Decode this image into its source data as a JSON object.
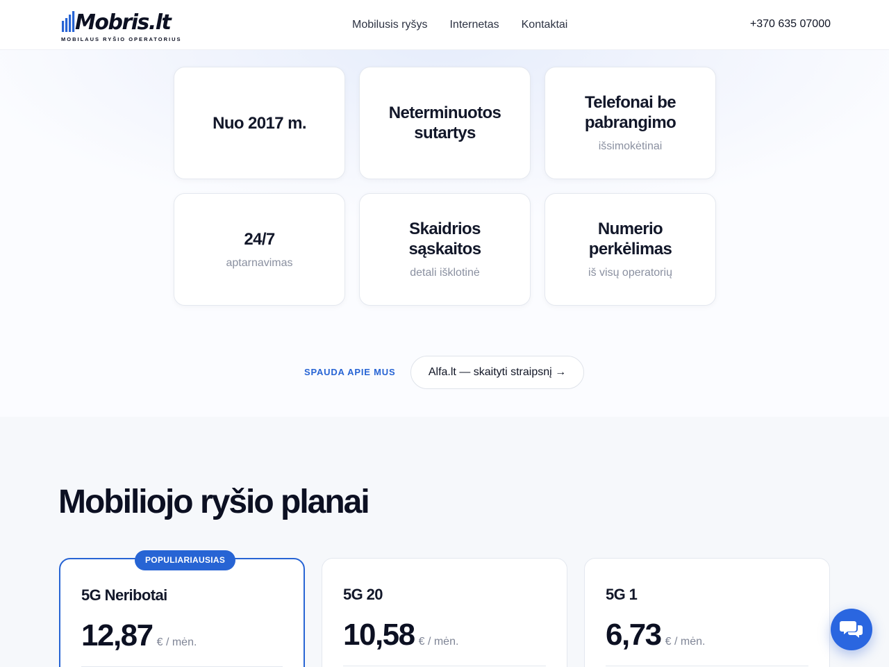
{
  "brand": {
    "name": "Mobris.lt",
    "tagline": "MOBILAUS RYŠIO OPERATORIUS",
    "accent": "#2764d4"
  },
  "nav": {
    "items": [
      "Mobilusis ryšys",
      "Internetas",
      "Kontaktai"
    ],
    "phone": "+370 635 07000"
  },
  "features": [
    {
      "title": "Nuo 2017 m.",
      "subtitle": ""
    },
    {
      "title": "Neterminuotos sutartys",
      "subtitle": ""
    },
    {
      "title": "Telefonai be pabrangimo",
      "subtitle": "išsimokėtinai"
    },
    {
      "title": "24/7",
      "subtitle": "aptarnavimas"
    },
    {
      "title": "Skaidrios sąskaitos",
      "subtitle": "detali išklotinė"
    },
    {
      "title": "Numerio perkėlimas",
      "subtitle": "iš visų operatorių"
    }
  ],
  "press": {
    "label": "SPAUDA APIE MUS",
    "link": "Alfa.lt — skaityti straipsnį →"
  },
  "plans": {
    "title": "Mobiliojo ryšio planai",
    "badge": "POPULIARIAUSIAS",
    "items": [
      {
        "name": "5G Neribotai",
        "price": "12,87",
        "unit": "€ / mėn."
      },
      {
        "name": "5G 20",
        "price": "10,58",
        "unit": "€ / mėn."
      },
      {
        "name": "5G 1",
        "price": "6,73",
        "unit": "€ / mėn."
      }
    ]
  },
  "icons": {
    "logo": "signal-bars-icon",
    "chat": "chat-bubbles-icon"
  }
}
